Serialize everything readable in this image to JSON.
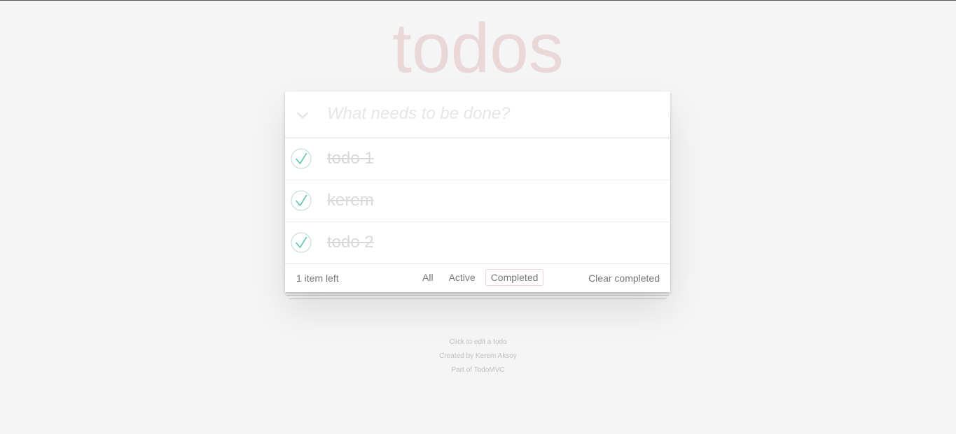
{
  "app": {
    "title": "todos"
  },
  "new_todo": {
    "placeholder": "What needs to be done?",
    "value": ""
  },
  "todos": [
    {
      "label": "todo 1",
      "completed": true
    },
    {
      "label": "kerem",
      "completed": true
    },
    {
      "label": "todo 2",
      "completed": true
    }
  ],
  "footer": {
    "count": "1 item left",
    "filters": [
      {
        "label": "All",
        "selected": false
      },
      {
        "label": "Active",
        "selected": false
      },
      {
        "label": "Completed",
        "selected": true
      }
    ],
    "clear_completed": "Clear completed"
  },
  "info": {
    "hint": "Click to edit a todo",
    "credit": "Created by Kerem Aksoy",
    "part_of": "Part of TodoMVC"
  },
  "icons": {
    "toggle_all": "chevron-down-icon",
    "todo_check": "checkmark-circle-icon"
  },
  "colors": {
    "title": "#eadada",
    "check": "#5dc2af",
    "selected_filter_border": "#efd5d5"
  }
}
